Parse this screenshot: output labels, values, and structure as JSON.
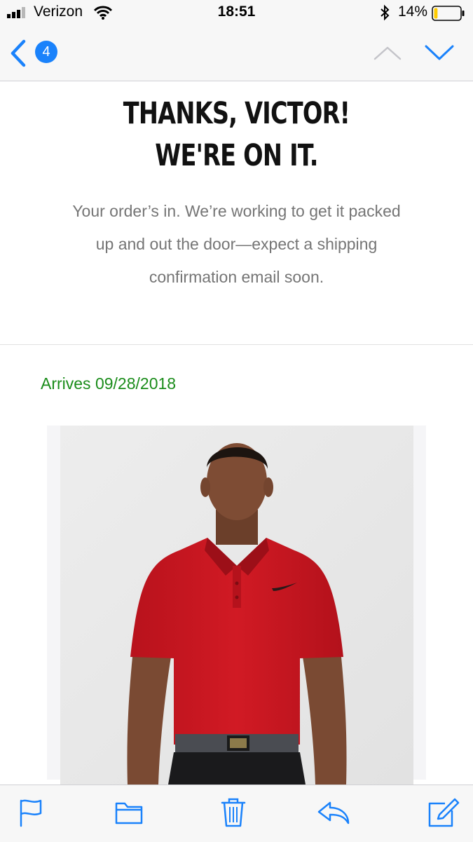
{
  "status_bar": {
    "carrier": "Verizon",
    "time": "18:51",
    "battery_percent": "14%",
    "battery_level": 0.14,
    "battery_color": "#ffcc00",
    "icons": [
      "signal-icon",
      "wifi-icon",
      "bluetooth-icon",
      "battery-icon"
    ]
  },
  "nav": {
    "back_icon": "chevron-left-icon",
    "unread_count": "4",
    "prev_icon": "chevron-up-icon",
    "next_icon": "chevron-down-icon"
  },
  "email": {
    "headline_line1": "THANKS, VICTOR!",
    "headline_line2": "WE'RE ON IT.",
    "body": "Your order’s in. We’re working to get it packed up and out the door—expect a shipping confirmation email soon.",
    "arrives": "Arrives 09/28/2018",
    "arrives_color": "#1a8c1a",
    "product_image": "product-photo-red-polo"
  },
  "toolbar": {
    "items": [
      "flag-icon",
      "folder-icon",
      "trash-icon",
      "reply-icon",
      "compose-icon"
    ]
  },
  "colors": {
    "accent": "#1a82fb",
    "headline": "#111111",
    "body_text": "#757575"
  }
}
